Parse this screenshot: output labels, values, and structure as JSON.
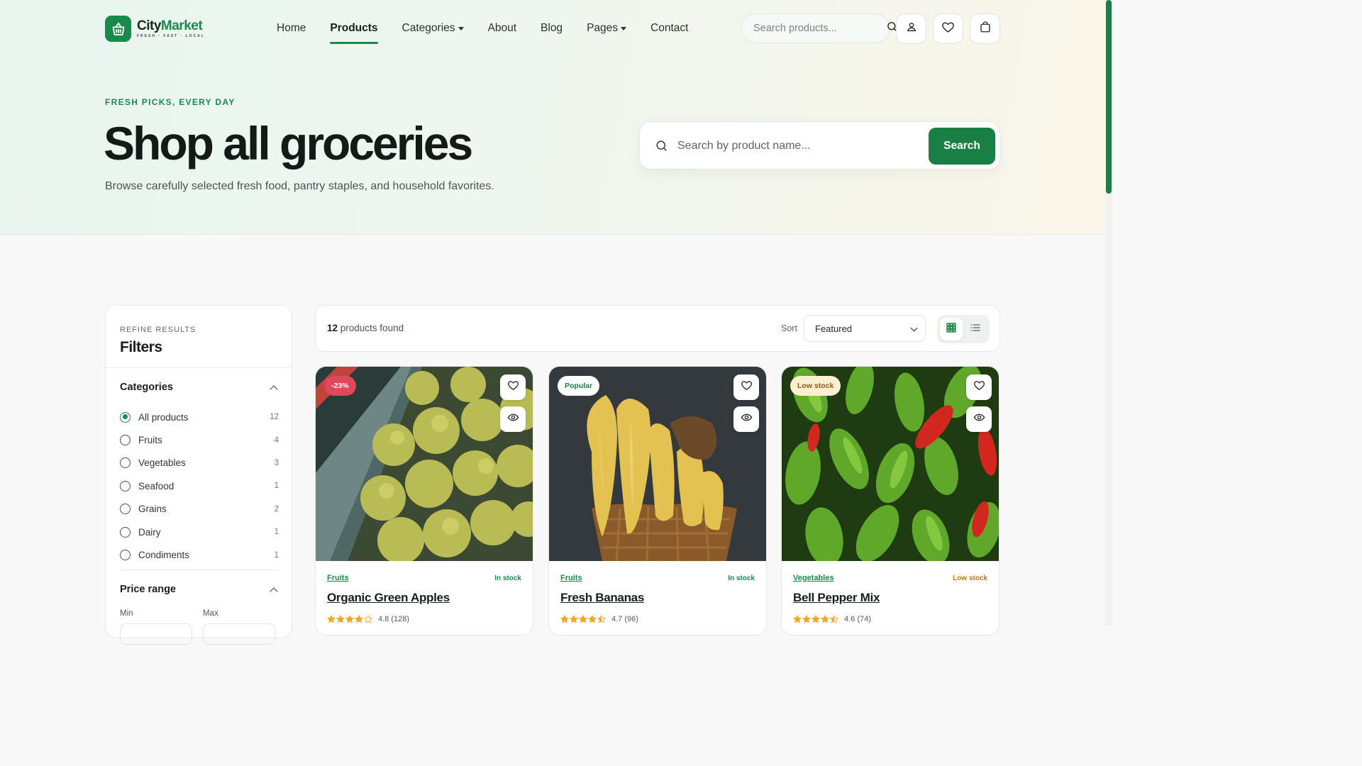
{
  "brand": {
    "name_part1": "City",
    "name_part2": "Market",
    "tagline": "FRESH · FAST · LOCAL"
  },
  "nav": {
    "items": [
      {
        "label": "Home",
        "dropdown": false,
        "active": false
      },
      {
        "label": "Products",
        "dropdown": false,
        "active": true
      },
      {
        "label": "Categories",
        "dropdown": true,
        "active": false
      },
      {
        "label": "About",
        "dropdown": false,
        "active": false
      },
      {
        "label": "Blog",
        "dropdown": false,
        "active": false
      },
      {
        "label": "Pages",
        "dropdown": true,
        "active": false
      },
      {
        "label": "Contact",
        "dropdown": false,
        "active": false
      }
    ],
    "search_placeholder": "Search products..."
  },
  "hero": {
    "eyebrow": "FRESH PICKS, EVERY DAY",
    "title": "Shop all groceries",
    "subtitle": "Browse carefully selected fresh food, pantry staples, and household favorites.",
    "search_placeholder": "Search by product name...",
    "search_button": "Search"
  },
  "filters": {
    "eyebrow": "REFINE RESULTS",
    "title": "Filters",
    "categories_heading": "Categories",
    "categories": [
      {
        "label": "All products",
        "count": "12",
        "checked": true
      },
      {
        "label": "Fruits",
        "count": "4",
        "checked": false
      },
      {
        "label": "Vegetables",
        "count": "3",
        "checked": false
      },
      {
        "label": "Seafood",
        "count": "1",
        "checked": false
      },
      {
        "label": "Grains",
        "count": "2",
        "checked": false
      },
      {
        "label": "Dairy",
        "count": "1",
        "checked": false
      },
      {
        "label": "Condiments",
        "count": "1",
        "checked": false
      }
    ],
    "price_heading": "Price range",
    "min_label": "Min",
    "max_label": "Max"
  },
  "results": {
    "count": "12",
    "count_suffix": " products found",
    "sort_label": "Sort",
    "sort_value": "Featured",
    "view_active": "grid"
  },
  "products": [
    {
      "name": "Organic Green Apples",
      "category": "Fruits",
      "stock": "In stock",
      "stock_color": "#1a8a4c",
      "badge": "-23%",
      "badge_style": "sale",
      "rating": "4.8",
      "reviews": "(128)",
      "stars": 4.0,
      "image": "green-apples"
    },
    {
      "name": "Fresh Bananas",
      "category": "Fruits",
      "stock": "In stock",
      "stock_color": "#1a8a4c",
      "badge": "Popular",
      "badge_style": "popular",
      "rating": "4.7",
      "reviews": "(96)",
      "stars": 4.5,
      "image": "bananas"
    },
    {
      "name": "Bell Pepper Mix",
      "category": "Vegetables",
      "stock": "Low stock",
      "stock_color": "#b7791f",
      "badge": "Low stock",
      "badge_style": "low",
      "rating": "4.6",
      "reviews": "(74)",
      "stars": 4.5,
      "image": "bell-peppers"
    }
  ],
  "colors": {
    "accent": "#1a8a4c",
    "sale": "#e0475b",
    "low": "#b7791f"
  }
}
